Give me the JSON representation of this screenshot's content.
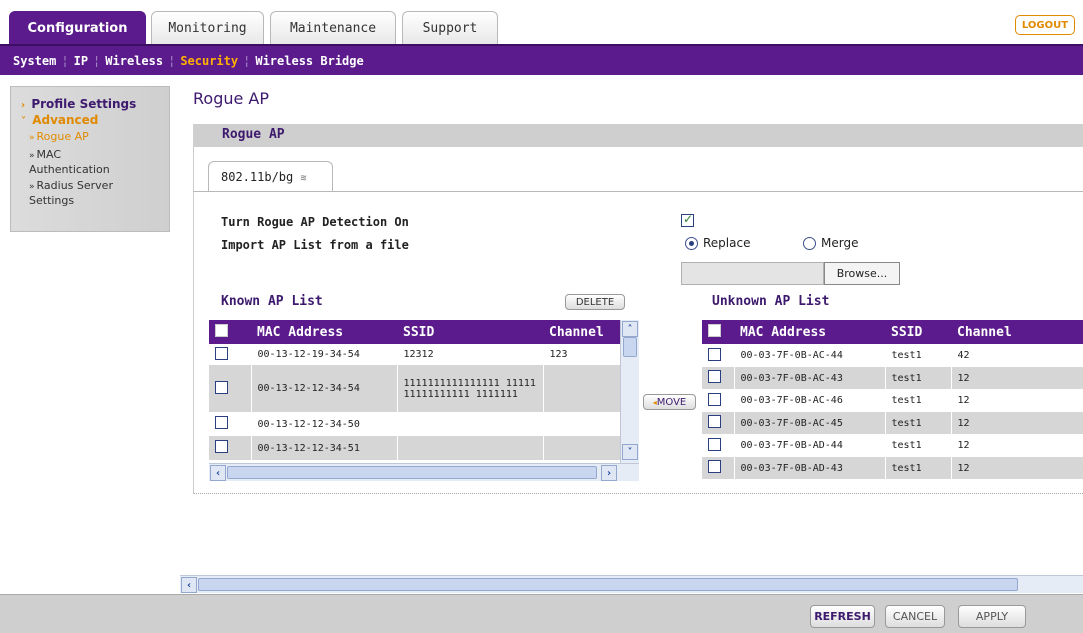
{
  "top_tabs": [
    "Configuration",
    "Monitoring",
    "Maintenance",
    "Support"
  ],
  "logout_label": "LOGOUT",
  "subnav": [
    "System",
    "IP",
    "Wireless",
    "Security",
    "Wireless Bridge"
  ],
  "left_menu": {
    "profile_settings": "Profile Settings",
    "advanced": "Advanced",
    "items": [
      "Rogue AP",
      "MAC Authentication",
      "Radius Server Settings"
    ]
  },
  "page_title": "Rogue AP",
  "panel_title": "Rogue AP",
  "band_tab": "802.11b/bg",
  "detection_label": "Turn Rogue AP Detection On",
  "detection_checked": true,
  "import_label": "Import AP List from a file",
  "radio_replace": "Replace",
  "radio_merge": "Merge",
  "radio_selected": "Replace",
  "browse_label": "Browse...",
  "known": {
    "title": "Known AP List",
    "delete_label": "DELETE",
    "headers": [
      "MAC Address",
      "SSID",
      "Channel"
    ],
    "rows": [
      {
        "mac": "00-13-12-19-34-54",
        "ssid": "12312",
        "channel": "123"
      },
      {
        "mac": "00-13-12-12-34-54",
        "ssid": "1111111111111111 1111111111111111 1111111",
        "channel": ""
      },
      {
        "mac": "00-13-12-12-34-50",
        "ssid": "",
        "channel": ""
      },
      {
        "mac": "00-13-12-12-34-51",
        "ssid": "",
        "channel": ""
      }
    ]
  },
  "move_label": "MOVE",
  "unknown": {
    "title": "Unknown AP List",
    "headers": [
      "MAC Address",
      "SSID",
      "Channel"
    ],
    "rows": [
      {
        "mac": "00-03-7F-0B-AC-44",
        "ssid": "test1",
        "channel": "42"
      },
      {
        "mac": "00-03-7F-0B-AC-43",
        "ssid": "test1",
        "channel": "12"
      },
      {
        "mac": "00-03-7F-0B-AC-46",
        "ssid": "test1",
        "channel": "12"
      },
      {
        "mac": "00-03-7F-0B-AC-45",
        "ssid": "test1",
        "channel": "12"
      },
      {
        "mac": "00-03-7F-0B-AD-44",
        "ssid": "test1",
        "channel": "12"
      },
      {
        "mac": "00-03-7F-0B-AD-43",
        "ssid": "test1",
        "channel": "12"
      }
    ]
  },
  "footer_buttons": [
    "REFRESH",
    "CANCEL",
    "APPLY"
  ],
  "colors": {
    "brand_purple": "#5b1b8c",
    "accent_orange": "#e08a00"
  }
}
